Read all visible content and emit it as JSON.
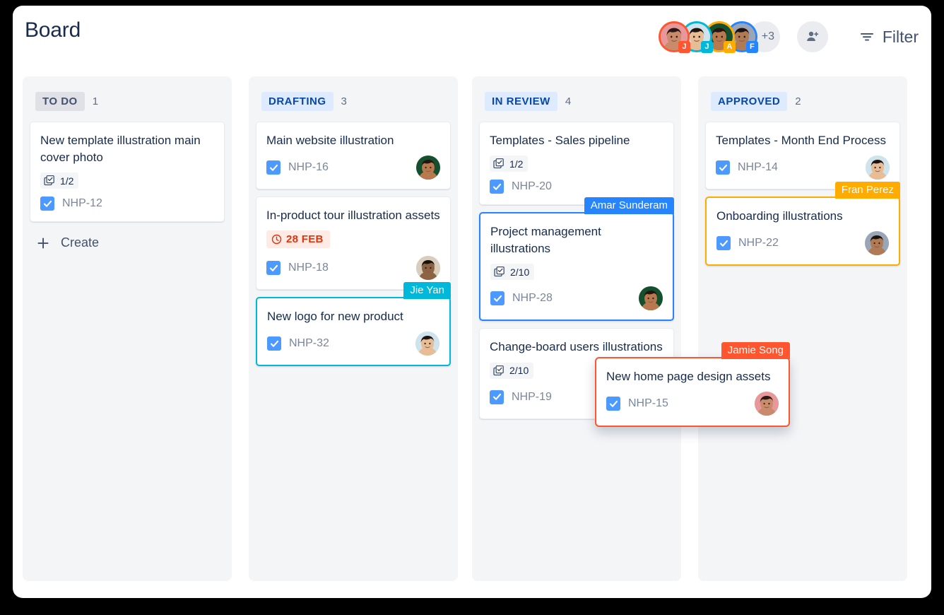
{
  "header": {
    "title": "Board",
    "avatars": [
      {
        "name": "Jamie Song",
        "initial": "J",
        "ring": "#ff5630",
        "badge": "#ff5630",
        "skin": "#c98b6b",
        "hair": "#2b1a14",
        "bg": "#e8989a"
      },
      {
        "name": "Jie Yan",
        "initial": "J",
        "ring": "#00b8d9",
        "badge": "#00b8d9",
        "skin": "#e8bc95",
        "hair": "#1d1410",
        "bg": "#cfe3ec"
      },
      {
        "name": "Amar Sunderam",
        "initial": "A",
        "ring": "#ffab00",
        "badge": "#ffab00",
        "skin": "#b8794f",
        "hair": "#241510",
        "bg": "#15502e"
      },
      {
        "name": "Fran Perez",
        "initial": "F",
        "ring": "#2684ff",
        "badge": "#2684ff",
        "skin": "#b07a55",
        "hair": "#1b120d",
        "bg": "#9aa6b5"
      }
    ],
    "avatar_overflow": "+3",
    "add_person_icon": "add-person-icon",
    "filter_icon": "filter-icon",
    "filter_label": "Filter"
  },
  "columns": [
    {
      "name": "TO DO",
      "count": "1",
      "chip_style": "chip-grey",
      "create_label": "Create",
      "cards": [
        {
          "title": "New template illustration main cover photo",
          "subtasks": "1/2",
          "issue_key": "NHP-12",
          "avatar": null,
          "drag": null,
          "due": null
        }
      ]
    },
    {
      "name": "DRAFTING",
      "count": "3",
      "chip_style": "chip-blue",
      "create_label": null,
      "cards": [
        {
          "title": "Main website illustration",
          "subtasks": null,
          "issue_key": "NHP-16",
          "avatar": {
            "skin": "#b8794f",
            "hair": "#241510",
            "bg": "#15502e"
          },
          "drag": null,
          "due": null
        },
        {
          "title": "In-product tour illustration assets",
          "subtasks": null,
          "issue_key": "NHP-18",
          "avatar": {
            "skin": "#8c6444",
            "hair": "#1a1108",
            "bg": "#d9cdbd"
          },
          "drag": null,
          "due": "28 FEB"
        },
        {
          "title": "New logo for new product",
          "subtasks": null,
          "issue_key": "NHP-32",
          "avatar": {
            "skin": "#e8bc95",
            "hair": "#1d1410",
            "bg": "#cfe3ec"
          },
          "drag": {
            "label": "Jie Yan",
            "color": "cyan"
          },
          "due": null
        }
      ]
    },
    {
      "name": "IN REVIEW",
      "count": "4",
      "chip_style": "chip-blue",
      "create_label": null,
      "cards": [
        {
          "title": "Templates - Sales pipeline",
          "subtasks": "1/2",
          "issue_key": "NHP-20",
          "avatar": null,
          "drag": null,
          "due": null
        },
        {
          "title": "Project management illustrations",
          "subtasks": "2/10",
          "issue_key": "NHP-28",
          "avatar": {
            "skin": "#b8794f",
            "hair": "#241510",
            "bg": "#15502e"
          },
          "drag": {
            "label": "Amar Sunderam",
            "color": "blue"
          },
          "due": null
        },
        {
          "title": "Change-board users illustrations",
          "subtasks": "2/10",
          "issue_key": "NHP-19",
          "avatar": {
            "skin": "#b8794f",
            "hair": "#241510",
            "bg": "#15502e"
          },
          "drag": null,
          "due": null
        }
      ]
    },
    {
      "name": "APPROVED",
      "count": "2",
      "chip_style": "chip-blue",
      "create_label": null,
      "cards": [
        {
          "title": "Templates - Month End Process",
          "subtasks": null,
          "issue_key": "NHP-14",
          "avatar": {
            "skin": "#e8bc95",
            "hair": "#1d1410",
            "bg": "#cfe3ec"
          },
          "drag": null,
          "due": null
        },
        {
          "title": "Onboarding illustrations",
          "subtasks": null,
          "issue_key": "NHP-22",
          "avatar": {
            "skin": "#b07a55",
            "hair": "#1b120d",
            "bg": "#9aa6b5"
          },
          "drag": {
            "label": "Fran Perez",
            "color": "amber"
          },
          "due": null
        }
      ]
    }
  ],
  "floating_card": {
    "title": "New home page design assets",
    "issue_key": "NHP-15",
    "drag": {
      "label": "Jamie Song",
      "color": "orange"
    },
    "avatar": {
      "skin": "#c98b6b",
      "hair": "#2b1a14",
      "bg": "#e8989a"
    }
  }
}
